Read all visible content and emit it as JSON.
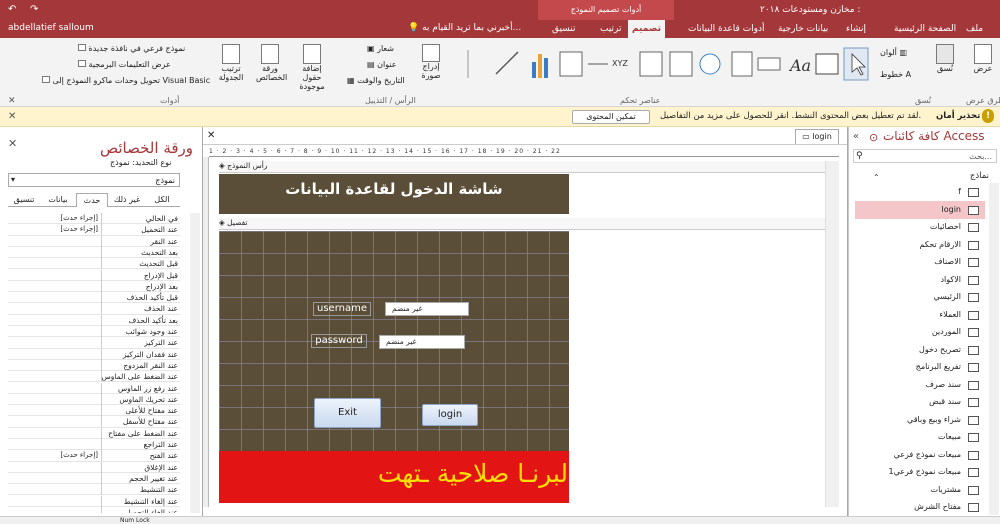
{
  "titlebar": {
    "title": "مخازن ومستودعات ٢٠١٨ :",
    "context": "أدوات تصميم النموذج",
    "user": "abdellatief salloum"
  },
  "tabs": [
    "ملف",
    "الصفحة الرئيسية",
    "إنشاء",
    "بيانات خارجية",
    "أدوات قاعدة البيانات",
    "تصميم",
    "ترتيب",
    "تنسيق"
  ],
  "tell_me": "أخبرني بما تريد القيام به...",
  "ribbon": {
    "views": "عرض",
    "themes_group": "نُسق",
    "theme_btn": "نُسق",
    "colors": "ألوان",
    "fonts": "خطوط",
    "controls_group": "عناصر تحكم",
    "insert_image": "إدراج صورة",
    "logo": "شعار",
    "title_btn": "عنوان",
    "datetime": "التاريخ والوقت",
    "header_group": "الرأس / التذييل",
    "add_fields": "إضافة حقول موجودة",
    "prop_sheet": "ورقة الخصائص",
    "tab_order": "ترتيب الجدولة",
    "subform": "نموذج فرعي في نافذة جديدة",
    "view_code": "عرض التعليمات البرمجية",
    "convert_macros": "تحويل وحدات ماكرو النموذج إلى Visual Basic",
    "tools_group": "أدوات",
    "views_label": "طرق عرض"
  },
  "warning": {
    "title": "تحذير أمان",
    "text": "لقد تم تعطيل بعض المحتوى النشط. انقر للحصول على مزيد من التفاصيل.",
    "button": "تمكين المحتوى"
  },
  "nav": {
    "title": "كافة كائنات Access",
    "search": "بحث...",
    "section": "نماذج",
    "items": [
      "f",
      "login",
      "احصائيات",
      "الارقام تحكم",
      "الاصناف",
      "الاكواد",
      "الرئيسي",
      "العملاء",
      "الموردين",
      "تصريح دخول",
      "تفريغ البرنامج",
      "سند صرف",
      "سند قبض",
      "شراء وبيع وباقي",
      "مبيعات",
      "مبيعات نموذج فرعي",
      "مبيعات نموذج فرعي1",
      "مشتريات",
      "مفتاح الشرش"
    ],
    "selected": "login"
  },
  "doc": {
    "tab": "login",
    "header_section": "رأس النموذج",
    "detail_section": "تفصيل",
    "form_title": "شاشة الدخول لقاعدة البيانات",
    "username_label": "username",
    "password_label": "password",
    "unbound": "غير منضم",
    "exit": "Exit",
    "login": "login",
    "marquee": "البرنـا صلاحية ـتهت",
    "ruler": "1 · 2 · 3 · 4 · 5 · 6 · 7 · 8 · 9 · 10 · 11 · 12 · 13 · 14 · 15 · 16 · 17 · 18 · 19 · 20 · 21 · 22"
  },
  "props": {
    "title": "ورقة الخصائص",
    "selection": "نوع التحديد: نموذج",
    "object": "نموذج",
    "tabs": [
      "تنسيق",
      "بيانات",
      "حدث",
      "غير ذلك",
      "الكل"
    ],
    "active_tab": "حدث",
    "rows": [
      {
        "label": "في الحالي",
        "value": "[إجراء حدث]"
      },
      {
        "label": "عند التحميل",
        "value": "[إجراء حدث]"
      },
      {
        "label": "عند النقر",
        "value": ""
      },
      {
        "label": "بعد التحديث",
        "value": ""
      },
      {
        "label": "قبل التحديث",
        "value": ""
      },
      {
        "label": "قبل الإدراج",
        "value": ""
      },
      {
        "label": "بعد الإدراج",
        "value": ""
      },
      {
        "label": "قبل تأكيد الحذف",
        "value": ""
      },
      {
        "label": "عند الحذف",
        "value": ""
      },
      {
        "label": "بعد تأكيد الحذف",
        "value": ""
      },
      {
        "label": "عند وجود شوائب",
        "value": ""
      },
      {
        "label": "عند التركيز",
        "value": ""
      },
      {
        "label": "عند فقدان التركيز",
        "value": ""
      },
      {
        "label": "عند النقر المزدوج",
        "value": ""
      },
      {
        "label": "عند الضغط على الماوس",
        "value": ""
      },
      {
        "label": "عند رفع زر الماوس",
        "value": ""
      },
      {
        "label": "عند تحريك الماوس",
        "value": ""
      },
      {
        "label": "عند مفتاح للأعلى",
        "value": ""
      },
      {
        "label": "عند مفتاح للأسفل",
        "value": ""
      },
      {
        "label": "عند الضغط على مفتاح",
        "value": ""
      },
      {
        "label": "عند التراجع",
        "value": ""
      },
      {
        "label": "عند الفتح",
        "value": "[إجراء حدث]"
      },
      {
        "label": "عند الإغلاق",
        "value": ""
      },
      {
        "label": "عند تغيير الحجم",
        "value": ""
      },
      {
        "label": "عند التنشيط",
        "value": ""
      },
      {
        "label": "عند إلغاء التنشيط",
        "value": ""
      },
      {
        "label": "عند إلغاء التحميل",
        "value": ""
      }
    ]
  },
  "status": {
    "numlock": "Num Lock"
  }
}
